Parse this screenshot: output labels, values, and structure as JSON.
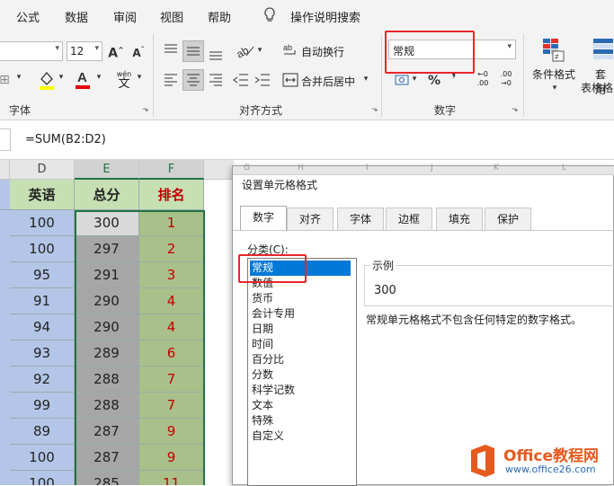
{
  "menu": {
    "items": [
      "公式",
      "数据",
      "审阅",
      "视图",
      "帮助"
    ],
    "tell_me": "操作说明搜索"
  },
  "ribbon": {
    "font_size": "12",
    "font_group_label": "字体",
    "wrap_text_label": "自动换行",
    "merge_center_label": "合并后居中",
    "alignment_group_label": "对齐方式",
    "number_format_value": "常规",
    "number_group_label": "数字",
    "cond_format_label": "条件格式",
    "table_format_label_line1": "套用",
    "table_format_label_line2": "表格格",
    "phonetic_glyph": "wén",
    "phonetic_glyph_char": "文",
    "percent_symbol": "%",
    "comma_symbol": "❜",
    "dec_inc_top": "←0",
    "dec_inc_bottom": ".00",
    "dec_dec_top": ".00",
    "dec_dec_bottom": "→0"
  },
  "formula_bar": {
    "formula": "=SUM(B2:D2)"
  },
  "grid": {
    "columns": [
      "D",
      "E",
      "F"
    ],
    "headers": [
      "英语",
      "总分",
      "排名"
    ],
    "rows": [
      [
        "100",
        "300",
        "1"
      ],
      [
        "100",
        "297",
        "2"
      ],
      [
        "95",
        "291",
        "3"
      ],
      [
        "91",
        "290",
        "4"
      ],
      [
        "94",
        "290",
        "4"
      ],
      [
        "93",
        "289",
        "6"
      ],
      [
        "92",
        "288",
        "7"
      ],
      [
        "99",
        "288",
        "7"
      ],
      [
        "89",
        "287",
        "9"
      ],
      [
        "100",
        "287",
        "9"
      ],
      [
        "100",
        "285",
        "11"
      ]
    ],
    "hidden_col_letters": [
      "G",
      "H",
      "I",
      "J",
      "K",
      "L"
    ]
  },
  "dialog": {
    "title": "设置单元格格式",
    "tabs": [
      "数字",
      "对齐",
      "字体",
      "边框",
      "填充",
      "保护"
    ],
    "category_label": "分类(C):",
    "categories": [
      "常规",
      "数值",
      "货币",
      "会计专用",
      "日期",
      "时间",
      "百分比",
      "分数",
      "科学记数",
      "文本",
      "特殊",
      "自定义"
    ],
    "selected_category": "常规",
    "sample_label": "示例",
    "sample_value": "300",
    "description": "常规单元格格式不包含任何特定的数字格式。"
  },
  "watermark": {
    "brand": "Office教程网",
    "url": "www.office26.com"
  },
  "colors": {
    "accent_green": "#217346",
    "highlight_red": "#e8262a",
    "rank_red": "#c00000",
    "col_d_fill": "#b4c6e7",
    "col_e_fill": "#a6a6a6",
    "col_f_fill": "#a9c08a",
    "header_fill": "#c6e0b4",
    "selection_blue": "#0078d7",
    "logo_orange": "#e65a1e"
  }
}
